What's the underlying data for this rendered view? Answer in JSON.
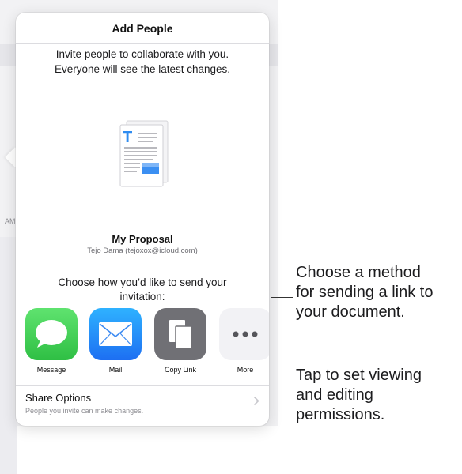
{
  "background": {
    "side_text": "AM"
  },
  "dialog": {
    "title": "Add People",
    "description_line1": "Invite people to collaborate with you.",
    "description_line2": "Everyone will see the latest changes.",
    "document": {
      "icon_letter": "T",
      "name": "My Proposal",
      "owner": "Tejo Dama (tejoxox@icloud.com)"
    },
    "choose_line1": "Choose how you’d like to send your",
    "choose_line2": "invitation:",
    "methods": [
      {
        "label": "Message",
        "icon": "message-icon",
        "color": "#34c759"
      },
      {
        "label": "Mail",
        "icon": "mail-icon",
        "color": "#1d7cf2"
      },
      {
        "label": "Copy Link",
        "icon": "copy-link-icon",
        "color": "#707075"
      },
      {
        "label": "More",
        "icon": "more-icon",
        "color": "#f2f2f5"
      }
    ],
    "share_options": {
      "title": "Share Options",
      "subtitle": "People you invite can make changes."
    }
  },
  "callouts": {
    "method": [
      "Choose a method",
      "for sending a link to",
      "your document."
    ],
    "permissions": [
      "Tap to set viewing",
      "and editing",
      "permissions."
    ]
  }
}
